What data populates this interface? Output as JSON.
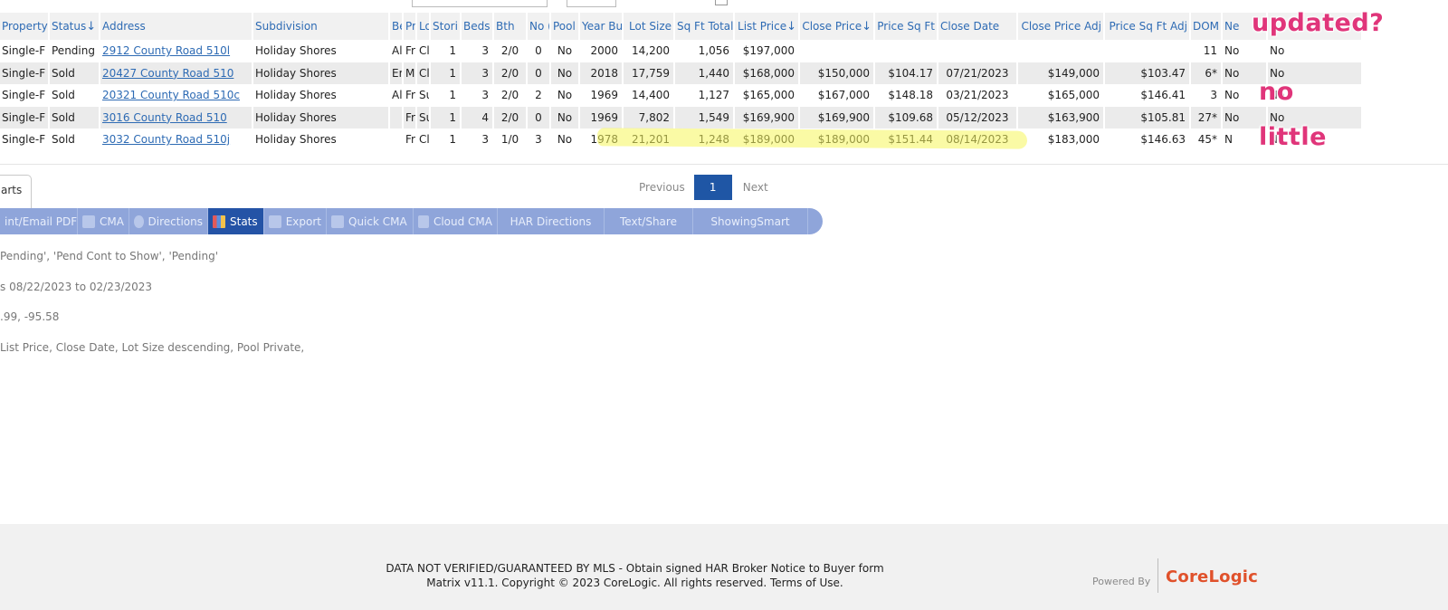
{
  "columns": [
    {
      "label": "Property",
      "sort": false
    },
    {
      "label": "Status",
      "sort": true
    },
    {
      "label": "Address",
      "sort": false
    },
    {
      "label": "Subdivision",
      "sort": false
    },
    {
      "label": "Be",
      "sort": false
    },
    {
      "label": "Pr",
      "sort": false
    },
    {
      "label": "Lo",
      "sort": false
    },
    {
      "label": "Stori",
      "sort": false
    },
    {
      "label": "Beds",
      "sort": false
    },
    {
      "label": "Bth",
      "sort": false
    },
    {
      "label": "No (",
      "sort": false
    },
    {
      "label": "Pool",
      "sort": false
    },
    {
      "label": "Year Bu",
      "sort": false
    },
    {
      "label": "Lot Size",
      "sort": false
    },
    {
      "label": "Sq Ft Total",
      "sort": false
    },
    {
      "label": "List Price",
      "sort": true
    },
    {
      "label": "Close Price",
      "sort": true
    },
    {
      "label": "Price Sq Ft",
      "sort": false
    },
    {
      "label": "Close Date",
      "sort": false
    },
    {
      "label": "Close Price Adj",
      "sort": false
    },
    {
      "label": "Price Sq Ft Adj",
      "sort": false
    },
    {
      "label": "DOM",
      "sort": false
    },
    {
      "label": "Ne",
      "sort": false
    },
    {
      "label": "",
      "sort": false
    }
  ],
  "rows": [
    [
      "Single-F",
      "Pending",
      "2912 County Road 510l",
      "Holiday Shores",
      "Al",
      "Fr",
      "Cl",
      "1",
      "3",
      "2/0",
      "0",
      "No",
      "2000",
      "14,200",
      "1,056",
      "$197,000",
      "",
      "",
      "",
      "",
      "",
      "11",
      "No",
      "No"
    ],
    [
      "Single-F",
      "Sold",
      "20427 County Road 510",
      "Holiday Shores",
      "Er",
      "M",
      "Cl",
      "1",
      "3",
      "2/0",
      "0",
      "No",
      "2018",
      "17,759",
      "1,440",
      "$168,000",
      "$150,000",
      "$104.17",
      "07/21/2023",
      "$149,000",
      "$103.47",
      "6*",
      "No",
      "No"
    ],
    [
      "Single-F",
      "Sold",
      "20321 County Road 510c",
      "Holiday Shores",
      "Al",
      "Fr",
      "Su",
      "1",
      "3",
      "2/0",
      "2",
      "No",
      "1969",
      "14,400",
      "1,127",
      "$165,000",
      "$167,000",
      "$148.18",
      "03/21/2023",
      "$165,000",
      "$146.41",
      "3",
      "No",
      "No"
    ],
    [
      "Single-F",
      "Sold",
      "3016 County Road 510",
      "Holiday Shores",
      "",
      "Fr",
      "Su",
      "1",
      "4",
      "2/0",
      "0",
      "No",
      "1969",
      "7,802",
      "1,549",
      "$169,900",
      "$169,900",
      "$109.68",
      "05/12/2023",
      "$163,900",
      "$105.81",
      "27*",
      "No",
      "No"
    ],
    [
      "Single-F",
      "Sold",
      "3032 County Road 510j",
      "Holiday Shores",
      "",
      "Fr",
      "Cl",
      "1",
      "3",
      "1/0",
      "3",
      "No",
      "1978",
      "21,201",
      "1,248",
      "$189,000",
      "$189,000",
      "$151.44",
      "08/14/2023",
      "$183,000",
      "$146.63",
      "45*",
      "N",
      "No"
    ]
  ],
  "annotations": {
    "updated": "updated?",
    "no": "no",
    "little": "little"
  },
  "tab": {
    "label": "arts"
  },
  "pager": {
    "previous": "Previous",
    "current": "1",
    "next": "Next"
  },
  "actions": [
    {
      "label": "int/Email PDF",
      "icon": "none"
    },
    {
      "label": "CMA",
      "icon": "document-icon"
    },
    {
      "label": "Directions",
      "icon": "compass-icon"
    },
    {
      "label": "Stats",
      "icon": "bar-chart-icon",
      "active": true
    },
    {
      "label": "Export",
      "icon": "export-icon"
    },
    {
      "label": "Quick CMA",
      "icon": "quick-cma-icon"
    },
    {
      "label": "Cloud CMA",
      "icon": "cloud-cma-icon"
    },
    {
      "label": "HAR Directions",
      "icon": "none"
    },
    {
      "label": "Text/Share",
      "icon": "none"
    },
    {
      "label": "ShowingSmart",
      "icon": "none"
    }
  ],
  "criteria": [
    "Pending', 'Pend Cont to Show', 'Pending'",
    "s 08/22/2023 to 02/23/2023",
    ".99, -95.58",
    "List Price, Close Date, Lot Size descending, Pool Private,"
  ],
  "footer": {
    "line1": "DATA NOT VERIFIED/GUARANTEED BY MLS - Obtain signed HAR Broker Notice to Buyer form",
    "line2": "Matrix v11.1. Copyright © 2023 CoreLogic. All rights reserved. Terms of Use.",
    "powered": "Powered By",
    "logo": "CoreLogic",
    "logo_color": "#e0512b"
  },
  "colors": {
    "link": "#2e6bb4",
    "active_button": "#2453a6",
    "actionbar": "#8fa5da",
    "highlight": "#f6f65b",
    "annotation": "#e0357a"
  }
}
